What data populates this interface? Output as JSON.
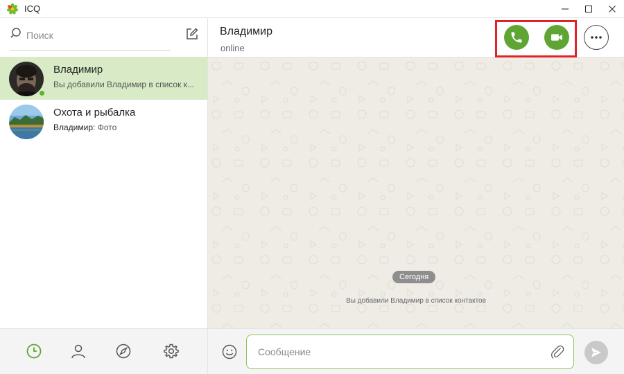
{
  "window": {
    "title": "ICQ",
    "logo_icon": "icq-flower-icon",
    "controls": [
      "minimize-icon",
      "maximize-icon",
      "close-icon"
    ]
  },
  "sidebar": {
    "search": {
      "placeholder": "Поиск",
      "value": ""
    },
    "compose_icon": "compose-icon",
    "contacts": [
      {
        "name": "Владимир",
        "preview": "Вы добавили Владимир в список к...",
        "active": true,
        "online": true
      },
      {
        "name": "Охота и рыбалка",
        "preview_sender": "Владимир:",
        "preview": "Фото",
        "active": false,
        "online": false
      }
    ],
    "nav": [
      "clock-icon",
      "person-icon",
      "compass-icon",
      "gear-icon"
    ]
  },
  "chat": {
    "title": "Владимир",
    "status": "online",
    "actions": [
      "phone-icon",
      "video-camera-icon",
      "more-icon"
    ],
    "date_pill": "Сегодня",
    "system_message": "Вы добавили Владимир в список контактов",
    "input": {
      "placeholder": "Сообщение",
      "value": ""
    }
  },
  "colors": {
    "accent": "#5fa534",
    "active_row": "#d8eac6",
    "highlight_box": "#e0232a",
    "chat_background": "#eeece5"
  }
}
